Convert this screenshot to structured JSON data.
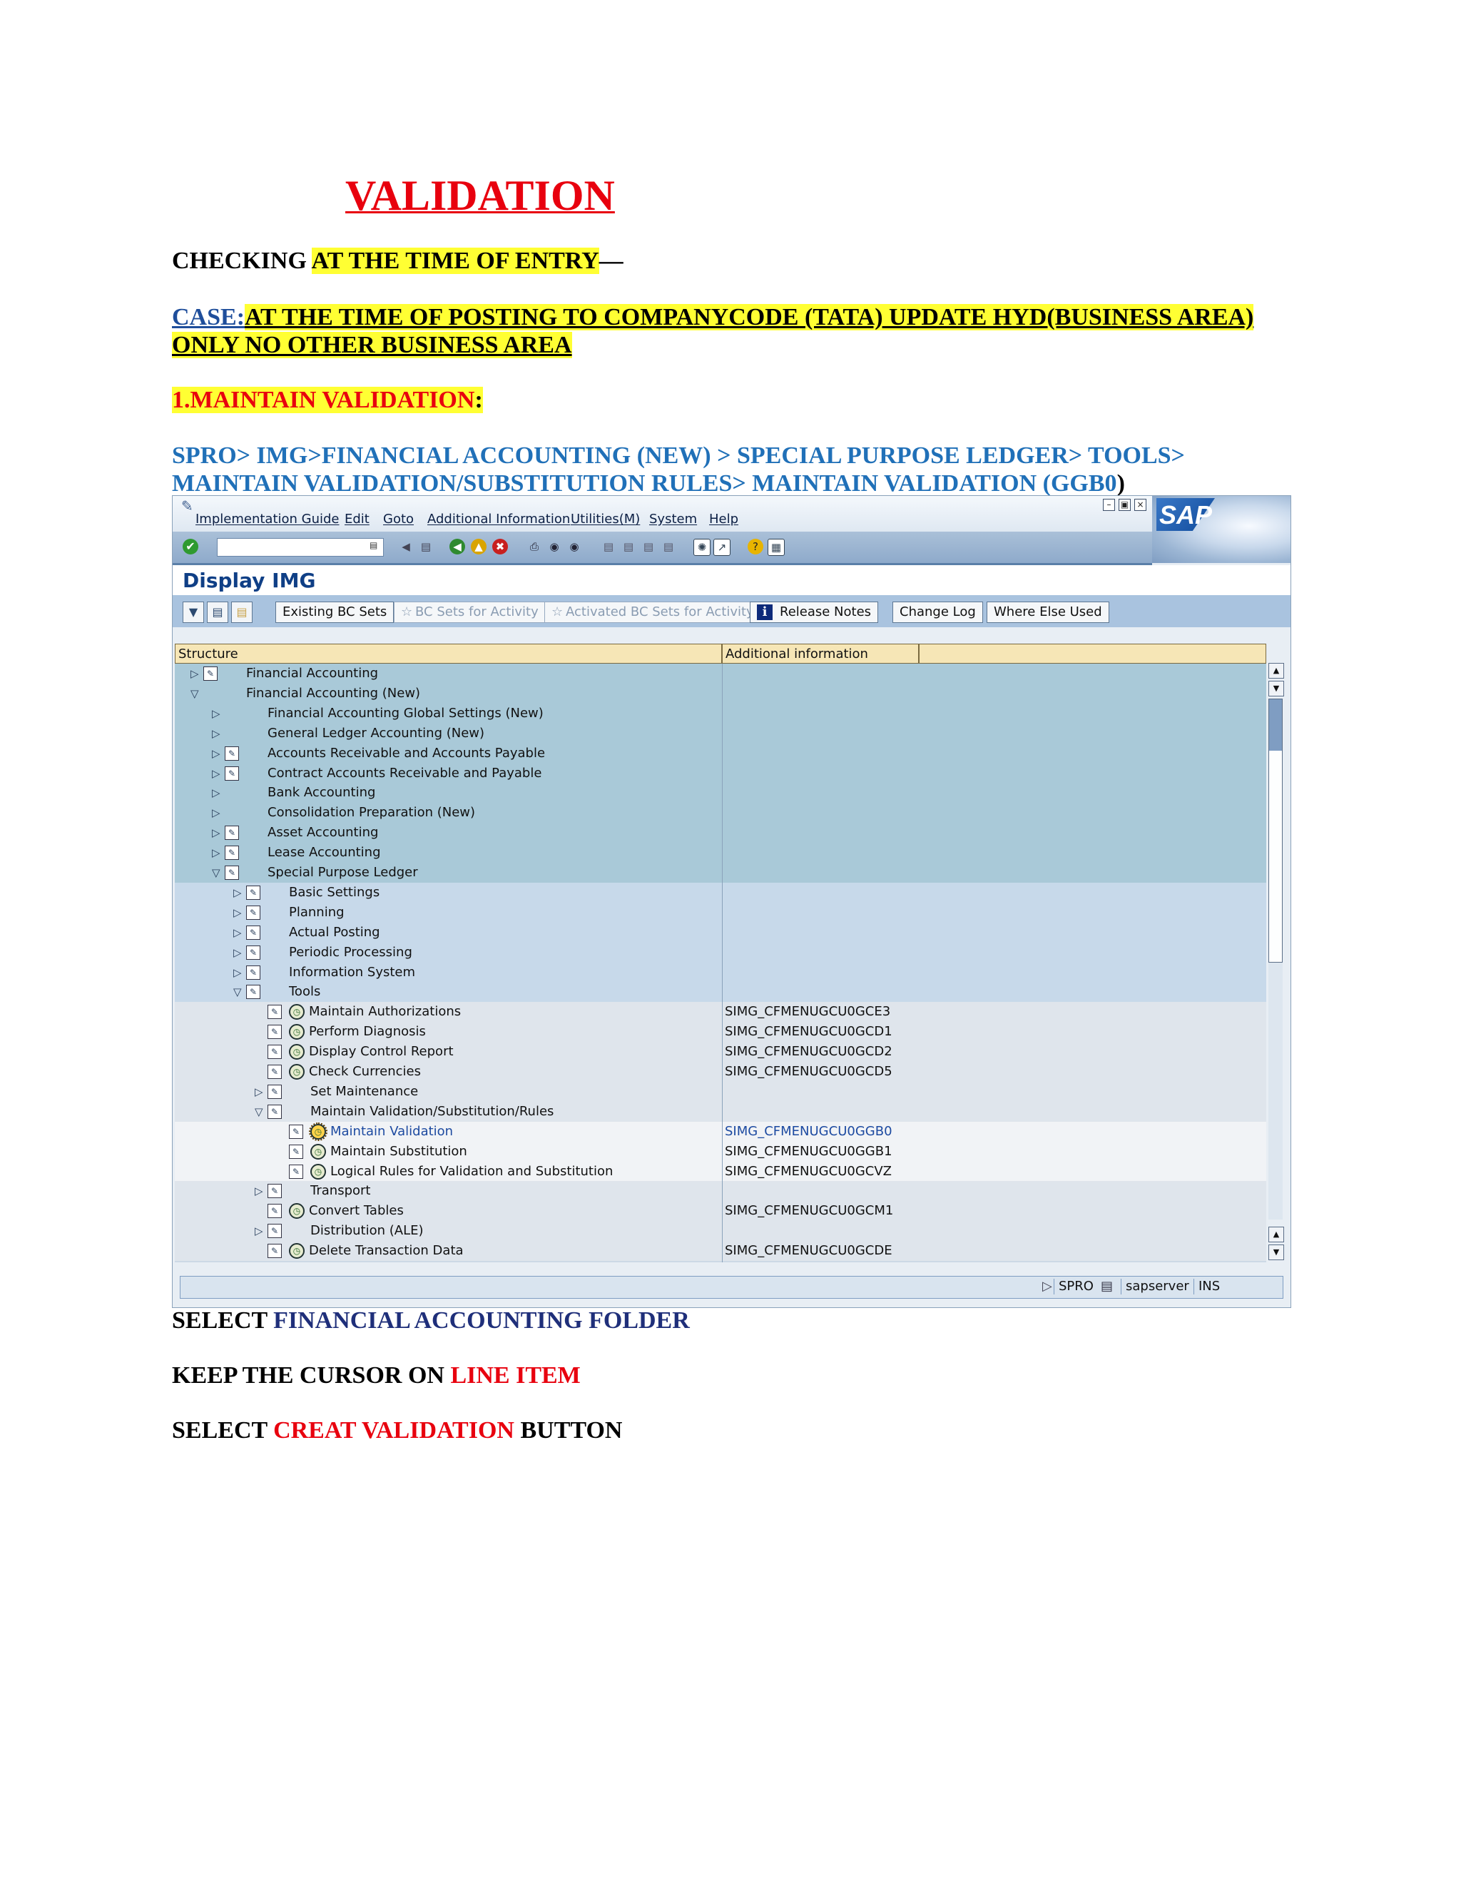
{
  "doc": {
    "title": "VALIDATION",
    "checking_pre": "CHECKING ",
    "checking_hl": "AT THE TIME OF ENTRY",
    "checking_post": "—",
    "case_label": "CASE:",
    "case_text": "AT THE TIME OF POSTING TO COMPANYCODE (TATA) UPDATE  HYD(BUSINESS AREA) ONLY   NO OTHER BUSINESS AREA",
    "step_text": "1.MAINTAIN VALIDATION",
    "step_colon": ":",
    "path": "SPRO> IMG>FINANCIAL ACCOUNTING (NEW) > SPECIAL PURPOSE LEDGER> TOOLS> MAINTAIN VALIDATION/SUBSTITUTION RULES> MAINTAIN VALIDATION (GGB0",
    "path_end": ")",
    "instr1_a": "SELECT ",
    "instr1_b": "FINANCIAL ACCOUNTING FOLDER",
    "instr2_a": "KEEP THE CURSOR ON ",
    "instr2_b": "LINE ITEM",
    "instr3_a": "SELECT ",
    "instr3_b": "CREAT VALIDATION",
    "instr3_c": " BUTTON"
  },
  "sap": {
    "menu": [
      "Implementation Guide",
      "Edit",
      "Goto",
      "Additional Information",
      "Utilities(M)",
      "System",
      "Help"
    ],
    "logo": "SAP",
    "screen_title": "Display IMG",
    "app_buttons": {
      "existing_bc_sets": "Existing BC Sets",
      "bc_sets_activity": "BC Sets for Activity",
      "activated_bc_sets": "Activated BC Sets for Activity",
      "release_notes": "Release Notes",
      "change_log": "Change Log",
      "where_else_used": "Where Else Used"
    },
    "columns": {
      "structure": "Structure",
      "additional": "Additional information"
    },
    "tree": [
      {
        "label": "Financial Accounting",
        "info": ""
      },
      {
        "label": "Financial Accounting (New)",
        "info": ""
      },
      {
        "label": "Financial Accounting Global Settings (New)",
        "info": ""
      },
      {
        "label": "General Ledger Accounting (New)",
        "info": ""
      },
      {
        "label": "Accounts Receivable and Accounts Payable",
        "info": ""
      },
      {
        "label": "Contract Accounts Receivable and Payable",
        "info": ""
      },
      {
        "label": "Bank Accounting",
        "info": ""
      },
      {
        "label": "Consolidation Preparation (New)",
        "info": ""
      },
      {
        "label": "Asset Accounting",
        "info": ""
      },
      {
        "label": "Lease Accounting",
        "info": ""
      },
      {
        "label": "Special Purpose Ledger",
        "info": ""
      },
      {
        "label": "Basic Settings",
        "info": ""
      },
      {
        "label": "Planning",
        "info": ""
      },
      {
        "label": "Actual Posting",
        "info": ""
      },
      {
        "label": "Periodic Processing",
        "info": ""
      },
      {
        "label": "Information System",
        "info": ""
      },
      {
        "label": "Tools",
        "info": ""
      },
      {
        "label": "Maintain Authorizations",
        "info": "SIMG_CFMENUGCU0GCE3"
      },
      {
        "label": "Perform Diagnosis",
        "info": "SIMG_CFMENUGCU0GCD1"
      },
      {
        "label": "Display Control Report",
        "info": "SIMG_CFMENUGCU0GCD2"
      },
      {
        "label": "Check Currencies",
        "info": "SIMG_CFMENUGCU0GCD5"
      },
      {
        "label": "Set Maintenance",
        "info": ""
      },
      {
        "label": "Maintain Validation/Substitution/Rules",
        "info": ""
      },
      {
        "label": "Maintain Validation",
        "info": "SIMG_CFMENUGCU0GGB0"
      },
      {
        "label": "Maintain Substitution",
        "info": "SIMG_CFMENUGCU0GGB1"
      },
      {
        "label": "Logical Rules for Validation and Substitution",
        "info": "SIMG_CFMENUGCU0GCVZ"
      },
      {
        "label": "Transport",
        "info": ""
      },
      {
        "label": "Convert Tables",
        "info": "SIMG_CFMENUGCU0GCM1"
      },
      {
        "label": "Distribution (ALE)",
        "info": ""
      },
      {
        "label": "Delete Transaction Data",
        "info": "SIMG_CFMENUGCU0GCDE"
      }
    ],
    "status": {
      "tcode": "SPRO",
      "server": "sapserver",
      "mode": "INS"
    }
  }
}
